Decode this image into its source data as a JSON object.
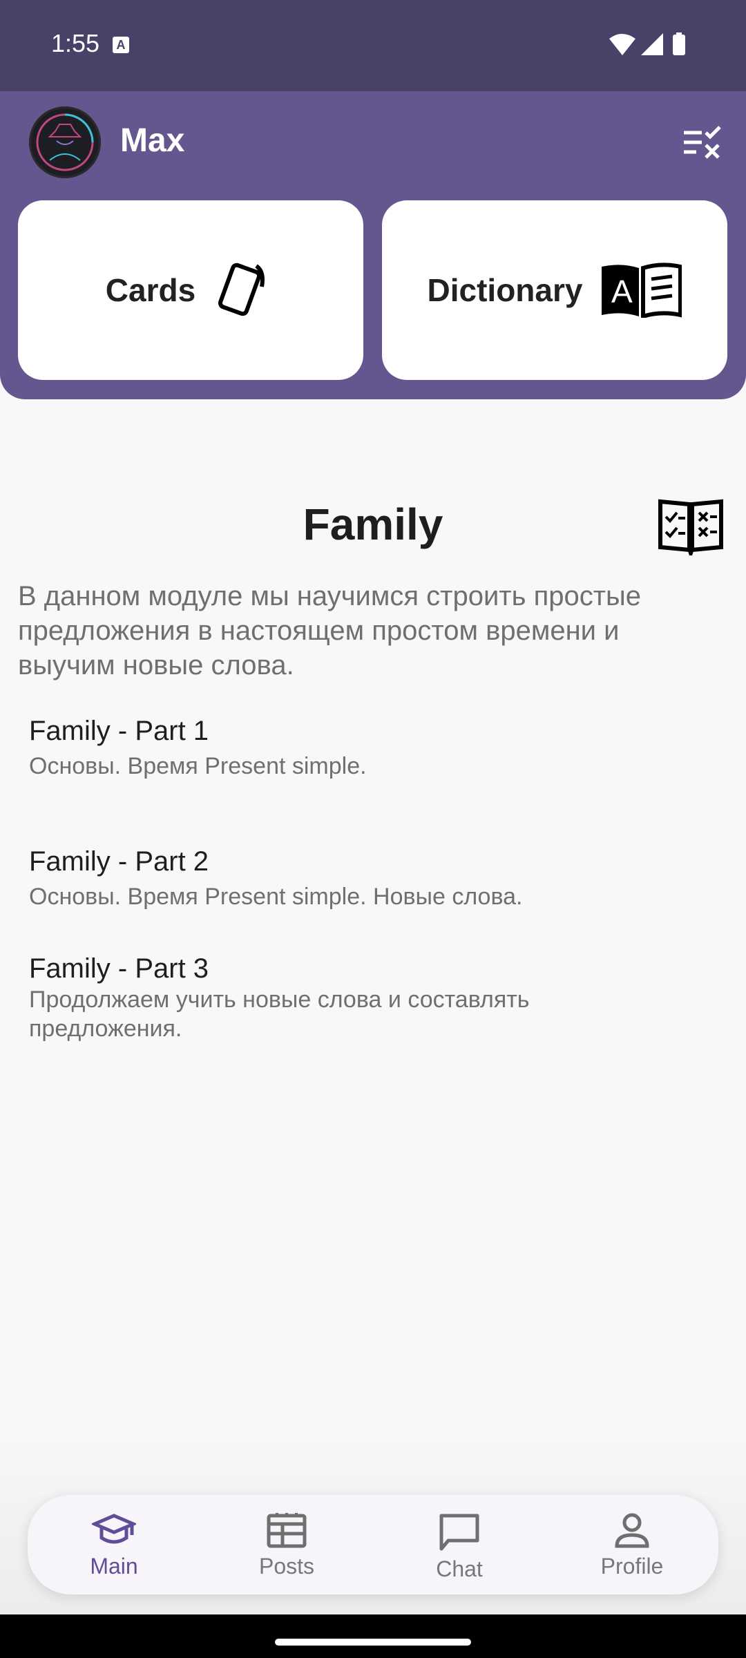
{
  "status": {
    "time": "1:55",
    "app_badge": "A"
  },
  "header": {
    "username": "Max"
  },
  "cards": [
    {
      "label": "Cards",
      "icon": "cards-icon"
    },
    {
      "label": "Dictionary",
      "icon": "dictionary-book-icon"
    }
  ],
  "module": {
    "title": "Family",
    "description": "В данном модуле мы научимся строить простые предложения в настоящем простом времени и выучим новые слова."
  },
  "parts": [
    {
      "title": "Family - Part 1",
      "subtitle": "Основы. Время Present simple."
    },
    {
      "title": "Family - Part 2",
      "subtitle": "Основы. Время Present simple. Новые слова."
    },
    {
      "title": "Family - Part 3",
      "subtitle": "Продолжаем учить новые слова и составлять предложения."
    }
  ],
  "nav": {
    "items": [
      {
        "label": "Main",
        "icon": "graduation-cap-icon",
        "active": true
      },
      {
        "label": "Posts",
        "icon": "posts-icon"
      },
      {
        "label": "Chat",
        "icon": "chat-icon"
      },
      {
        "label": "Profile",
        "icon": "profile-icon"
      }
    ]
  },
  "colors": {
    "status_bar": "#4a4168",
    "header": "#645790",
    "accent": "#5e4e98"
  }
}
